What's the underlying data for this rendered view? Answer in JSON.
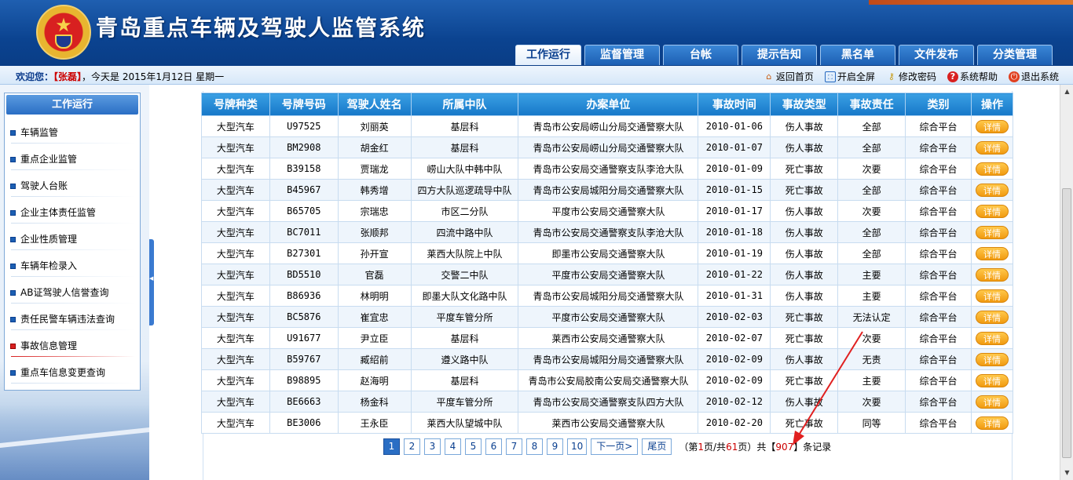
{
  "app": {
    "title": "青岛重点车辆及驾驶人监管系统"
  },
  "tabs": [
    {
      "label": "工作运行",
      "active": true
    },
    {
      "label": "监督管理",
      "active": false
    },
    {
      "label": "台帐",
      "active": false
    },
    {
      "label": "提示告知",
      "active": false
    },
    {
      "label": "黑名单",
      "active": false
    },
    {
      "label": "文件发布",
      "active": false
    },
    {
      "label": "分类管理",
      "active": false
    }
  ],
  "welcome": {
    "label": "欢迎您：",
    "user": "【张磊】",
    "date_text": "，今天是 2015年1月12日 星期一"
  },
  "toolbar": {
    "home": "返回首页",
    "fullscreen": "开启全屏",
    "password": "修改密码",
    "help": "系统帮助",
    "logout": "退出系统"
  },
  "sidebar": {
    "title": "工作运行",
    "items": [
      {
        "label": "车辆监管",
        "active": false
      },
      {
        "label": "重点企业监管",
        "active": false
      },
      {
        "label": "驾驶人台账",
        "active": false
      },
      {
        "label": "企业主体责任监管",
        "active": false
      },
      {
        "label": "企业性质管理",
        "active": false
      },
      {
        "label": "车辆年检录入",
        "active": false
      },
      {
        "label": "AB证驾驶人信誉查询",
        "active": false
      },
      {
        "label": "责任民警车辆违法查询",
        "active": false
      },
      {
        "label": "事故信息管理",
        "active": true
      },
      {
        "label": "重点车信息变更查询",
        "active": false
      }
    ]
  },
  "table": {
    "columns": [
      "号牌种类",
      "号牌号码",
      "驾驶人姓名",
      "所属中队",
      "办案单位",
      "事故时间",
      "事故类型",
      "事故责任",
      "类别",
      "操作"
    ],
    "detail_label": "详情",
    "rows": [
      [
        "大型汽车",
        "U97525",
        "刘丽英",
        "基层科",
        "青岛市公安局崂山分局交通警察大队",
        "2010-01-06",
        "伤人事故",
        "全部",
        "综合平台"
      ],
      [
        "大型汽车",
        "BM2908",
        "胡金红",
        "基层科",
        "青岛市公安局崂山分局交通警察大队",
        "2010-01-07",
        "伤人事故",
        "全部",
        "综合平台"
      ],
      [
        "大型汽车",
        "B39158",
        "贾瑞龙",
        "崂山大队中韩中队",
        "青岛市公安局交通警察支队李沧大队",
        "2010-01-09",
        "死亡事故",
        "次要",
        "综合平台"
      ],
      [
        "大型汽车",
        "B45967",
        "韩秀增",
        "四方大队巡逻疏导中队",
        "青岛市公安局城阳分局交通警察大队",
        "2010-01-15",
        "死亡事故",
        "全部",
        "综合平台"
      ],
      [
        "大型汽车",
        "B65705",
        "宗瑞忠",
        "市区二分队",
        "平度市公安局交通警察大队",
        "2010-01-17",
        "伤人事故",
        "次要",
        "综合平台"
      ],
      [
        "大型汽车",
        "BC7011",
        "张顺邦",
        "四流中路中队",
        "青岛市公安局交通警察支队李沧大队",
        "2010-01-18",
        "伤人事故",
        "全部",
        "综合平台"
      ],
      [
        "大型汽车",
        "B27301",
        "孙开宣",
        "莱西大队院上中队",
        "即墨市公安局交通警察大队",
        "2010-01-19",
        "伤人事故",
        "全部",
        "综合平台"
      ],
      [
        "大型汽车",
        "BD5510",
        "官磊",
        "交警二中队",
        "平度市公安局交通警察大队",
        "2010-01-22",
        "伤人事故",
        "主要",
        "综合平台"
      ],
      [
        "大型汽车",
        "B86936",
        "林明明",
        "即墨大队文化路中队",
        "青岛市公安局城阳分局交通警察大队",
        "2010-01-31",
        "伤人事故",
        "主要",
        "综合平台"
      ],
      [
        "大型汽车",
        "BC5876",
        "崔宜忠",
        "平度车管分所",
        "平度市公安局交通警察大队",
        "2010-02-03",
        "死亡事故",
        "无法认定",
        "综合平台"
      ],
      [
        "大型汽车",
        "U91677",
        "尹立臣",
        "基层科",
        "莱西市公安局交通警察大队",
        "2010-02-07",
        "死亡事故",
        "次要",
        "综合平台"
      ],
      [
        "大型汽车",
        "B59767",
        "臧绍前",
        "遵义路中队",
        "青岛市公安局城阳分局交通警察大队",
        "2010-02-09",
        "伤人事故",
        "无责",
        "综合平台"
      ],
      [
        "大型汽车",
        "B98895",
        "赵海明",
        "基层科",
        "青岛市公安局胶南公安局交通警察大队",
        "2010-02-09",
        "死亡事故",
        "主要",
        "综合平台"
      ],
      [
        "大型汽车",
        "BE6663",
        "杨金科",
        "平度车管分所",
        "青岛市公安局交通警察支队四方大队",
        "2010-02-12",
        "伤人事故",
        "次要",
        "综合平台"
      ],
      [
        "大型汽车",
        "BE3006",
        "王永臣",
        "莱西大队望城中队",
        "莱西市公安局交通警察大队",
        "2010-02-20",
        "死亡事故",
        "同等",
        "综合平台"
      ]
    ]
  },
  "pagination": {
    "pages": [
      "1",
      "2",
      "3",
      "4",
      "5",
      "6",
      "7",
      "8",
      "9",
      "10"
    ],
    "current": "1",
    "next": "下一页>",
    "last": "尾页",
    "info_prefix": "（第",
    "info_page": "1",
    "info_mid": "页/共",
    "info_total_pages": "61",
    "info_mid2": "页）共【",
    "info_total_records": "907",
    "info_suffix": "】条记录"
  },
  "colors": {
    "header_blue": "#0b4390",
    "table_header": "#1677c8",
    "detail_button": "#f19a10",
    "annotation_arrow": "#e02020"
  }
}
